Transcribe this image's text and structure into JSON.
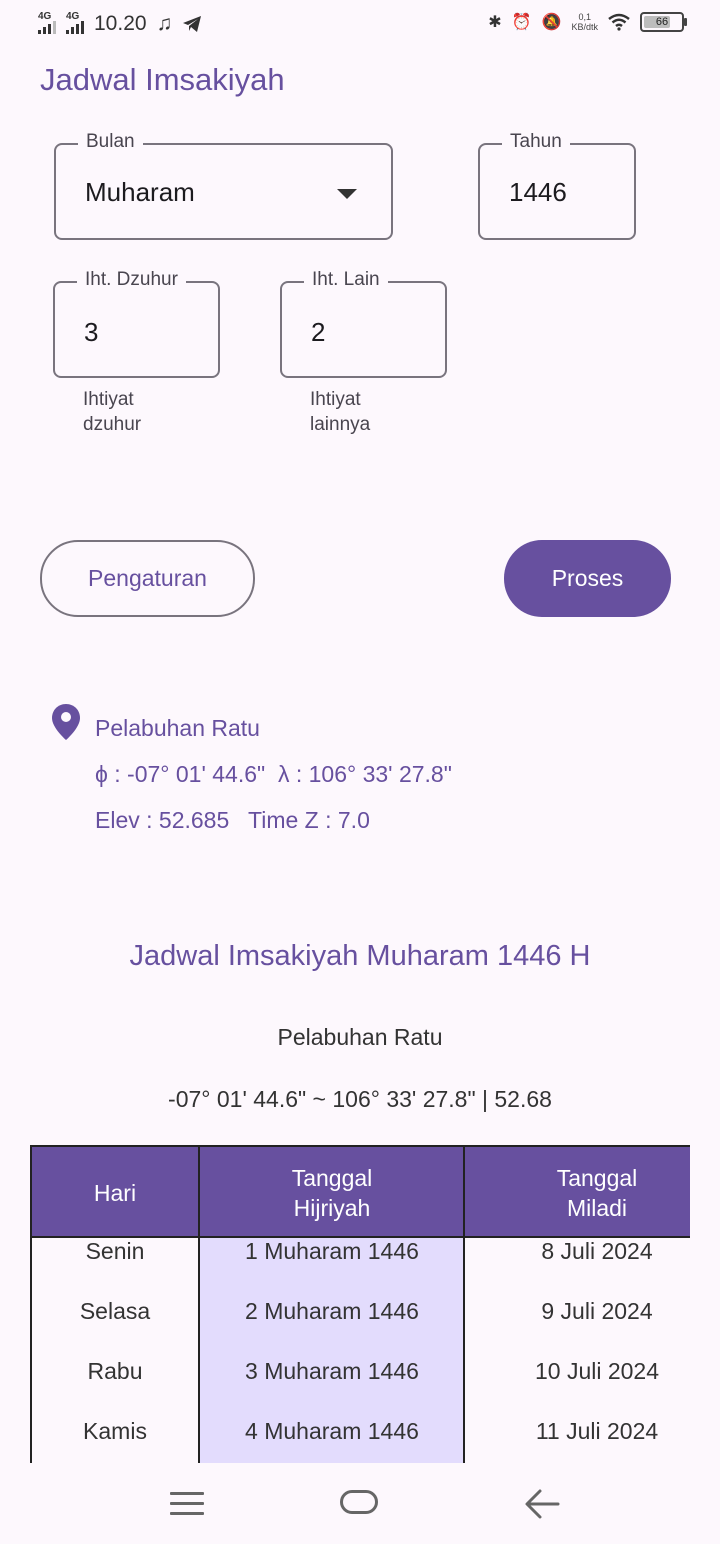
{
  "status_bar": {
    "network_1": "4G",
    "network_2": "4G",
    "time": "10.20",
    "net_speed_value": "0,1",
    "net_speed_unit": "KB/dtk",
    "battery": "66"
  },
  "app_title": "Jadwal Imsakiyah",
  "form": {
    "bulan": {
      "label": "Bulan",
      "value": "Muharam"
    },
    "tahun": {
      "label": "Tahun",
      "value": "1446"
    },
    "iht_dzuhur": {
      "label": "Iht. Dzuhur",
      "value": "3",
      "helper": "Ihtiyat dzuhur"
    },
    "iht_lain": {
      "label": "Iht. Lain",
      "value": "2",
      "helper": "Ihtiyat lainnya"
    }
  },
  "buttons": {
    "settings": "Pengaturan",
    "process": "Proses"
  },
  "location": {
    "name": "Pelabuhan Ratu",
    "coords": "ϕ : -07° 01' 44.6\"  λ : 106° 33' 27.8\"",
    "elev": "Elev : 52.685   Time Z : 7.0"
  },
  "schedule": {
    "title": "Jadwal Imsakiyah Muharam 1446 H",
    "place": "Pelabuhan Ratu",
    "coords": "-07° 01' 44.6\" ~ 106° 33' 27.8\" | 52.68",
    "headers": [
      "Hari",
      "Tanggal\nHijriyah",
      "Tanggal\nMiladi"
    ],
    "rows": [
      {
        "hari": "Senin",
        "hijriyah": "1 Muharam 1446",
        "miladi": "8 Juli 2024"
      },
      {
        "hari": "Selasa",
        "hijriyah": "2 Muharam 1446",
        "miladi": "9 Juli 2024"
      },
      {
        "hari": "Rabu",
        "hijriyah": "3 Muharam 1446",
        "miladi": "10 Juli 2024"
      },
      {
        "hari": "Kamis",
        "hijriyah": "4 Muharam 1446",
        "miladi": "11 Juli 2024"
      }
    ]
  },
  "colors": {
    "primary": "#67509f",
    "highlight_column": "#e3dcfd",
    "background": "#fdf8fd"
  }
}
